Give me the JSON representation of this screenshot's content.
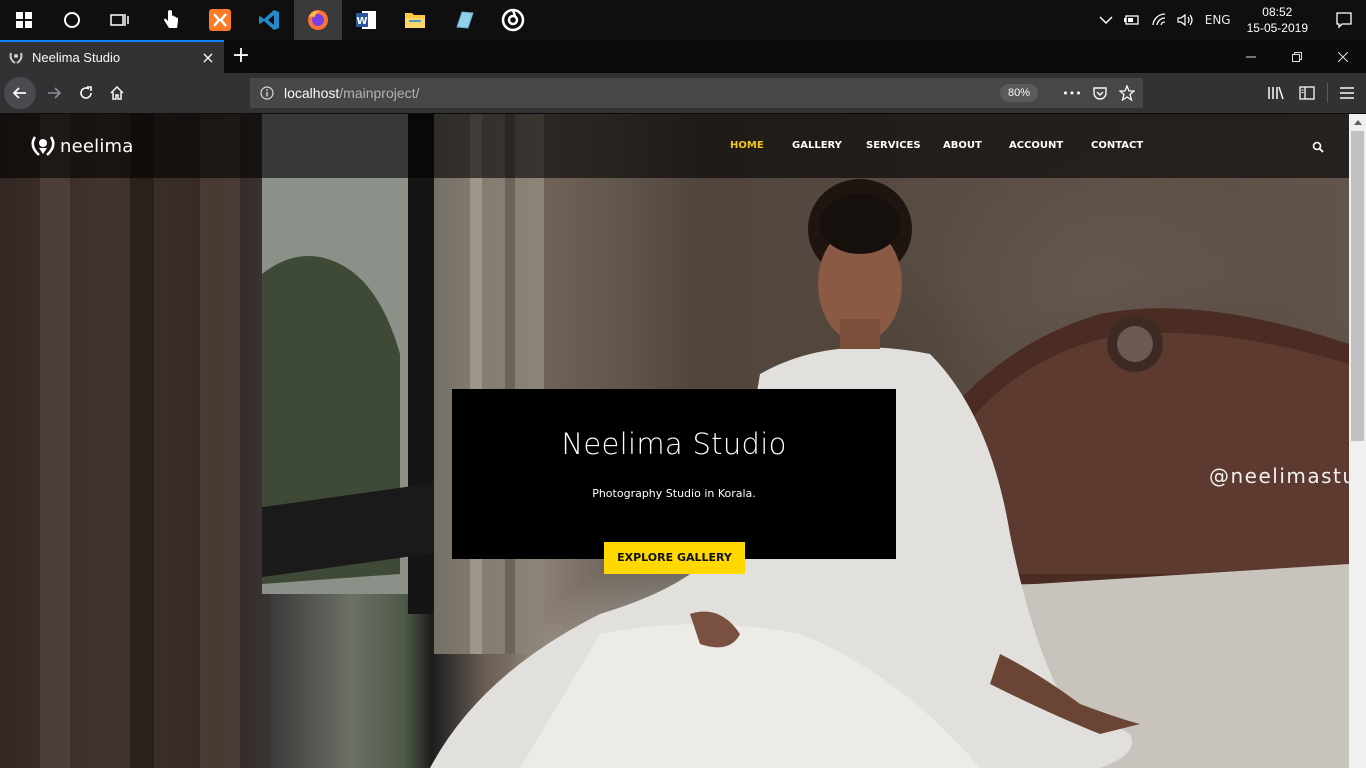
{
  "taskbar": {
    "apps": [
      {
        "name": "start",
        "icon": "windows-logo-icon"
      },
      {
        "name": "cortana",
        "icon": "cortana-circle-icon"
      },
      {
        "name": "task-view",
        "icon": "task-view-icon"
      },
      {
        "name": "touch",
        "icon": "hand-pointer-icon"
      },
      {
        "name": "xampp",
        "icon": "xampp-icon"
      },
      {
        "name": "vscode",
        "icon": "vscode-icon"
      },
      {
        "name": "firefox",
        "icon": "firefox-icon",
        "active": true
      },
      {
        "name": "word",
        "icon": "word-icon"
      },
      {
        "name": "file-explorer",
        "icon": "folder-icon"
      },
      {
        "name": "notepad",
        "icon": "notepad-icon"
      },
      {
        "name": "media",
        "icon": "target-icon"
      }
    ],
    "tray": {
      "language": "ENG",
      "time": "08:52",
      "date": "15-05-2019"
    }
  },
  "browser": {
    "tab_title": "Neelima Studio",
    "tab_close": "×",
    "new_tab": "+",
    "url_host": "localhost",
    "url_path": "/mainproject/",
    "zoom": "80%",
    "page_actions": "•••"
  },
  "site": {
    "logo_text": "neelima",
    "menu": [
      {
        "label": "HOME",
        "active": true
      },
      {
        "label": "GALLERY",
        "active": false
      },
      {
        "label": "SERVICES",
        "active": false
      },
      {
        "label": "ABOUT",
        "active": false
      },
      {
        "label": "ACCOUNT",
        "active": false
      },
      {
        "label": "CONTACT",
        "active": false
      }
    ],
    "hero": {
      "title": "Neelima Studio",
      "subtitle": "Photography Studio in Korala.",
      "button": "EXPLORE GALLERY"
    },
    "watermark": "@neelimastud"
  },
  "colors": {
    "accent": "#f5c518",
    "button_bg": "#ffd800",
    "firefox_tab_highlight": "#0a84ff"
  }
}
